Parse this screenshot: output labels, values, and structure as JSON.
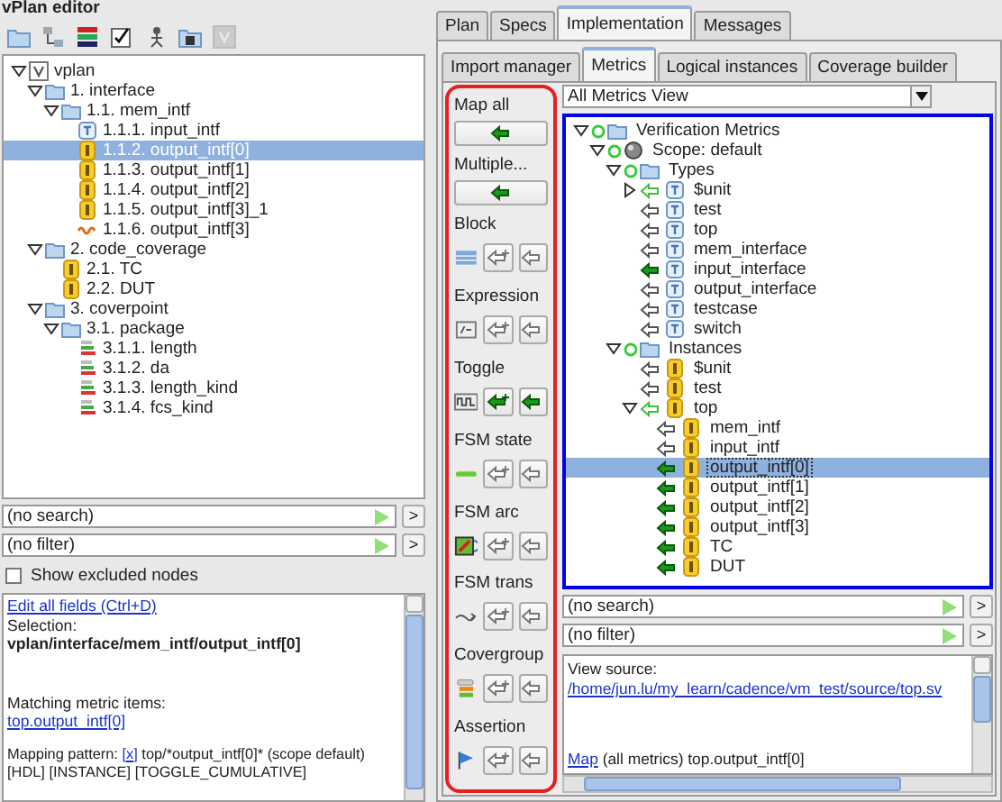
{
  "left": {
    "title": "vPlan editor",
    "toolbar": [
      {
        "kind": "folder",
        "disabled": false
      },
      {
        "kind": "network",
        "disabled": false
      },
      {
        "kind": "books",
        "disabled": false
      },
      {
        "kind": "checklist",
        "disabled": false
      },
      {
        "kind": "figure",
        "disabled": false
      },
      {
        "kind": "folder-arrow",
        "disabled": false
      },
      {
        "kind": "root",
        "disabled": true
      }
    ],
    "tree": [
      {
        "label": "vplan",
        "kind": "root",
        "expanded": true,
        "selected": false,
        "children": [
          {
            "label": "1. interface",
            "kind": "folder",
            "expanded": true,
            "selected": false,
            "children": [
              {
                "label": "1.1. mem_intf",
                "kind": "folder",
                "expanded": true,
                "selected": false,
                "children": [
                  {
                    "label": "1.1.1. input_intf",
                    "kind": "type",
                    "selected": false
                  },
                  {
                    "label": "1.1.2. output_intf[0]",
                    "kind": "instance",
                    "selected": true
                  },
                  {
                    "label": "1.1.3. output_intf[1]",
                    "kind": "instance",
                    "selected": false
                  },
                  {
                    "label": "1.1.4. output_intf[2]",
                    "kind": "instance",
                    "selected": false
                  },
                  {
                    "label": "1.1.5. output_intf[3]_1",
                    "kind": "instance",
                    "selected": false
                  },
                  {
                    "label": "1.1.6. output_intf[3]",
                    "kind": "cov",
                    "selected": false
                  }
                ]
              }
            ]
          },
          {
            "label": "2. code_coverage",
            "kind": "folder",
            "expanded": true,
            "selected": false,
            "children": [
              {
                "label": "2.1. TC",
                "kind": "instance",
                "selected": false
              },
              {
                "label": "2.2. DUT",
                "kind": "instance",
                "selected": false
              }
            ]
          },
          {
            "label": "3. coverpoint",
            "kind": "folder",
            "expanded": true,
            "selected": false,
            "children": [
              {
                "label": "3.1. package",
                "kind": "folder",
                "expanded": true,
                "selected": false,
                "children": [
                  {
                    "label": "3.1.1. length",
                    "kind": "coverpoint",
                    "selected": false
                  },
                  {
                    "label": "3.1.2. da",
                    "kind": "coverpoint",
                    "selected": false
                  },
                  {
                    "label": "3.1.3. length_kind",
                    "kind": "coverpoint",
                    "selected": false
                  },
                  {
                    "label": "3.1.4. fcs_kind",
                    "kind": "coverpoint",
                    "selected": false
                  }
                ]
              }
            ]
          }
        ]
      }
    ],
    "search": {
      "value": "(no search)",
      "button": ">"
    },
    "filter": {
      "value": "(no filter)",
      "button": ">"
    },
    "show_excluded": {
      "label": "Show excluded nodes",
      "checked": false
    },
    "details": {
      "edit_link": "Edit all fields (Ctrl+D)",
      "selection_label": "Selection:",
      "selection_path": "vplan/interface/mem_intf/output_intf[0]",
      "matching_label": "Matching metric items:",
      "matching_link": "top.output_intf[0]",
      "mapping_prefix": "Mapping pattern:",
      "mapping_link": "[x]",
      "mapping_rest": "top/*output_intf[0]* (scope default) [HDL] [INSTANCE] [TOGGLE_CUMULATIVE]"
    }
  },
  "right": {
    "tabs": [
      {
        "label": "Plan",
        "selected": false
      },
      {
        "label": "Specs",
        "selected": false
      },
      {
        "label": "Implementation",
        "selected": true
      },
      {
        "label": "Messages",
        "selected": false
      }
    ],
    "subtabs": [
      {
        "label": "Import manager",
        "selected": false
      },
      {
        "label": "Metrics",
        "selected": true
      },
      {
        "label": "Logical instances",
        "selected": false
      },
      {
        "label": "Coverage builder",
        "selected": false
      }
    ],
    "map_all": {
      "label": "Map all"
    },
    "multiple": {
      "label": "Multiple..."
    },
    "sections": [
      {
        "label": "Block",
        "kind": "block",
        "enabled": false
      },
      {
        "label": "Expression",
        "kind": "expression",
        "enabled": false
      },
      {
        "label": "Toggle",
        "kind": "toggle",
        "enabled": true
      },
      {
        "label": "FSM state",
        "kind": "fsm-state",
        "enabled": false
      },
      {
        "label": "FSM arc",
        "kind": "fsm-arc",
        "enabled": false
      },
      {
        "label": "FSM trans",
        "kind": "fsm-trans",
        "enabled": false
      },
      {
        "label": "Covergroup",
        "kind": "covergroup",
        "enabled": false
      },
      {
        "label": "Assertion",
        "kind": "assertion",
        "enabled": false
      }
    ],
    "view": {
      "value": "All Metrics View"
    },
    "tree": [
      {
        "label": "Verification Metrics",
        "kind": "folder",
        "ring": true,
        "expanded": true,
        "selected": false,
        "children": [
          {
            "label": "Scope: default",
            "kind": "scope",
            "ring": true,
            "expanded": true,
            "selected": false,
            "children": [
              {
                "label": "Types",
                "kind": "folder",
                "ring": true,
                "expanded": true,
                "selected": false,
                "children": [
                  {
                    "label": "$unit",
                    "kind": "type",
                    "mapped": false,
                    "partial": true,
                    "expanded": false,
                    "selected": false
                  },
                  {
                    "label": "test",
                    "kind": "type",
                    "mapped": false,
                    "partial": false,
                    "selected": false
                  },
                  {
                    "label": "top",
                    "kind": "type",
                    "mapped": false,
                    "partial": false,
                    "selected": false
                  },
                  {
                    "label": "mem_interface",
                    "kind": "type",
                    "mapped": false,
                    "partial": false,
                    "selected": false
                  },
                  {
                    "label": "input_interface",
                    "kind": "type",
                    "mapped": true,
                    "partial": false,
                    "selected": false
                  },
                  {
                    "label": "output_interface",
                    "kind": "type",
                    "mapped": false,
                    "partial": false,
                    "selected": false
                  },
                  {
                    "label": "testcase",
                    "kind": "type",
                    "mapped": false,
                    "partial": false,
                    "selected": false
                  },
                  {
                    "label": "switch",
                    "kind": "type",
                    "mapped": false,
                    "partial": false,
                    "selected": false
                  }
                ]
              },
              {
                "label": "Instances",
                "kind": "folder",
                "ring": true,
                "expanded": true,
                "selected": false,
                "children": [
                  {
                    "label": "$unit",
                    "kind": "instance",
                    "mapped": false,
                    "partial": false,
                    "selected": false
                  },
                  {
                    "label": "test",
                    "kind": "instance",
                    "mapped": false,
                    "partial": false,
                    "selected": false
                  },
                  {
                    "label": "top",
                    "kind": "instance",
                    "mapped": false,
                    "partial": true,
                    "expanded": true,
                    "selected": false,
                    "children": [
                      {
                        "label": "mem_intf",
                        "kind": "instance",
                        "mapped": false,
                        "partial": false,
                        "selected": false
                      },
                      {
                        "label": "input_intf",
                        "kind": "instance",
                        "mapped": false,
                        "partial": false,
                        "selected": false
                      },
                      {
                        "label": "output_intf[0]",
                        "kind": "instance",
                        "mapped": true,
                        "partial": false,
                        "selected": true
                      },
                      {
                        "label": "output_intf[1]",
                        "kind": "instance",
                        "mapped": true,
                        "partial": false,
                        "selected": false
                      },
                      {
                        "label": "output_intf[2]",
                        "kind": "instance",
                        "mapped": true,
                        "partial": false,
                        "selected": false
                      },
                      {
                        "label": "output_intf[3]",
                        "kind": "instance",
                        "mapped": true,
                        "partial": false,
                        "selected": false
                      },
                      {
                        "label": "TC",
                        "kind": "instance",
                        "mapped": true,
                        "partial": false,
                        "selected": false
                      },
                      {
                        "label": "DUT",
                        "kind": "instance",
                        "mapped": true,
                        "partial": false,
                        "selected": false
                      }
                    ]
                  }
                ]
              }
            ]
          }
        ]
      }
    ],
    "search": {
      "value": "(no search)",
      "button": ">"
    },
    "filter": {
      "value": "(no filter)",
      "button": ">"
    },
    "source": {
      "label": "View source:",
      "path_link": "/home/jun.lu/my_learn/cadence/vm_test/source/top.sv",
      "map_link": "Map",
      "map_rest": "(all metrics) top.output_intf[0]"
    }
  }
}
